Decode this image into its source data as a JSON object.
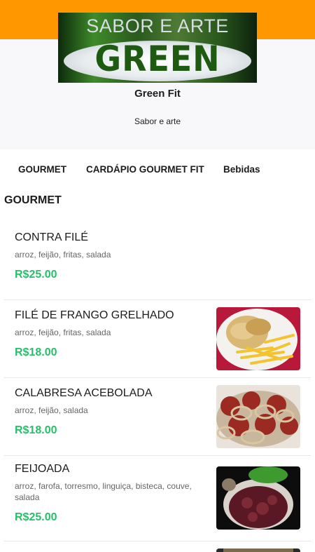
{
  "store": {
    "logo_top_text": "SABOR E ARTE",
    "logo_main_text": "GREEN FIT",
    "name": "Green Fit",
    "tagline": "Sabor e arte"
  },
  "tabs": [
    {
      "label": "GOURMET"
    },
    {
      "label": "CARDÁPIO GOURMET FIT"
    },
    {
      "label": "Bebidas"
    }
  ],
  "section": {
    "title": "GOURMET"
  },
  "items": [
    {
      "name": "CONTRA FILÉ",
      "description": "arroz, feijão, fritas, salada",
      "price": "R$25.00",
      "photo": "none"
    },
    {
      "name": "FILÉ DE FRANGO GRELHADO",
      "description": "arroz, feijão, fritas, salada",
      "price": "R$18.00",
      "photo": "grilled-chicken-fries-photo"
    },
    {
      "name": "CALABRESA ACEBOLADA",
      "description": "arroz, feijão, salada",
      "price": "R$18.00",
      "photo": "sausage-onions-photo"
    },
    {
      "name": "FEIJOADA",
      "description": "arroz, farofa, torresmo, linguiça, bisteca, couve, salada",
      "price": "R$25.00",
      "photo": "feijoada-photo"
    }
  ],
  "colors": {
    "top_bar": "#ff9800",
    "price": "#27c06a",
    "header_bg": "#f8f8fa"
  }
}
